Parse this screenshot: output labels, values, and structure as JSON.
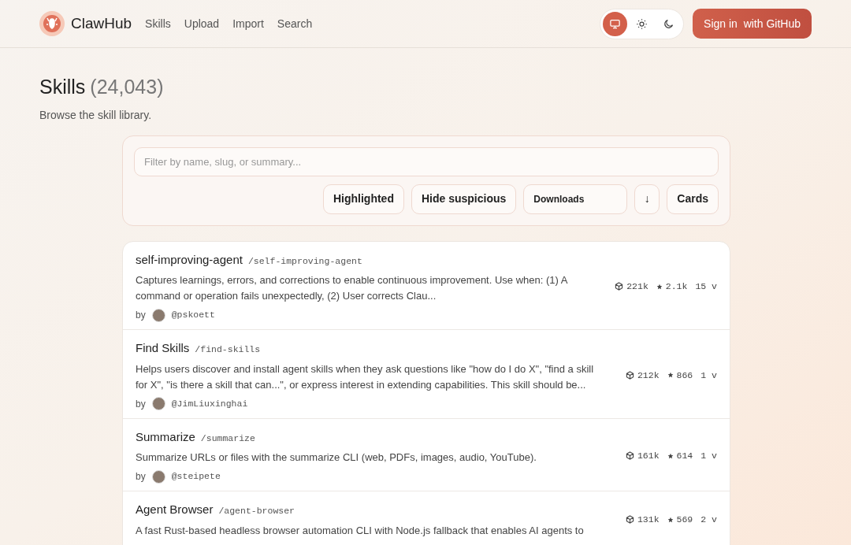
{
  "header": {
    "brand": "ClawHub",
    "nav": [
      {
        "label": "Skills"
      },
      {
        "label": "Upload"
      },
      {
        "label": "Import"
      },
      {
        "label": "Search"
      }
    ],
    "theme": [
      {
        "kind": "system",
        "selected": true
      },
      {
        "kind": "light",
        "selected": false
      },
      {
        "kind": "dark",
        "selected": false
      }
    ],
    "sign_in": {
      "label": "Sign in",
      "suffix": "with GitHub"
    }
  },
  "page": {
    "title": "Skills",
    "count": "(24,043)",
    "subtitle": "Browse the skill library."
  },
  "filters": {
    "search": {
      "placeholder": "Filter by name, slug, or summary..."
    },
    "buttons": [
      {
        "kind": "toggle",
        "label": "Highlighted"
      },
      {
        "kind": "toggle",
        "label": "Hide suspicious"
      },
      {
        "kind": "select",
        "label": "Downloads"
      },
      {
        "kind": "direction",
        "label": "↓"
      },
      {
        "kind": "toggle",
        "label": "Cards"
      }
    ]
  },
  "skills": [
    {
      "name": "self-improving-agent",
      "slug": "/self-improving-agent",
      "summary": "Captures learnings, errors, and corrections to enable continuous improvement. Use when: (1) A command or operation fails unexpectedly, (2) User corrects Clau...",
      "by": "by",
      "author": "@pskoett",
      "downloads": "221k",
      "stars": "2.1k",
      "versions": "15 v"
    },
    {
      "name": "Find Skills",
      "slug": "/find-skills",
      "summary": "Helps users discover and install agent skills when they ask questions like \"how do I do X\", \"find a skill for X\", \"is there a skill that can...\", or express interest in extending capabilities. This skill should be...",
      "by": "by",
      "author": "@JimLiuxinghai",
      "downloads": "212k",
      "stars": "866",
      "versions": "1 v"
    },
    {
      "name": "Summarize",
      "slug": "/summarize",
      "summary": "Summarize URLs or files with the summarize CLI (web, PDFs, images, audio, YouTube).",
      "by": "by",
      "author": "@steipete",
      "downloads": "161k",
      "stars": "614",
      "versions": "1 v"
    },
    {
      "name": "Agent Browser",
      "slug": "/agent-browser",
      "summary": "A fast Rust-based headless browser automation CLI with Node.js fallback that enables AI agents to",
      "downloads": "131k",
      "stars": "569",
      "versions": "2 v"
    }
  ]
}
